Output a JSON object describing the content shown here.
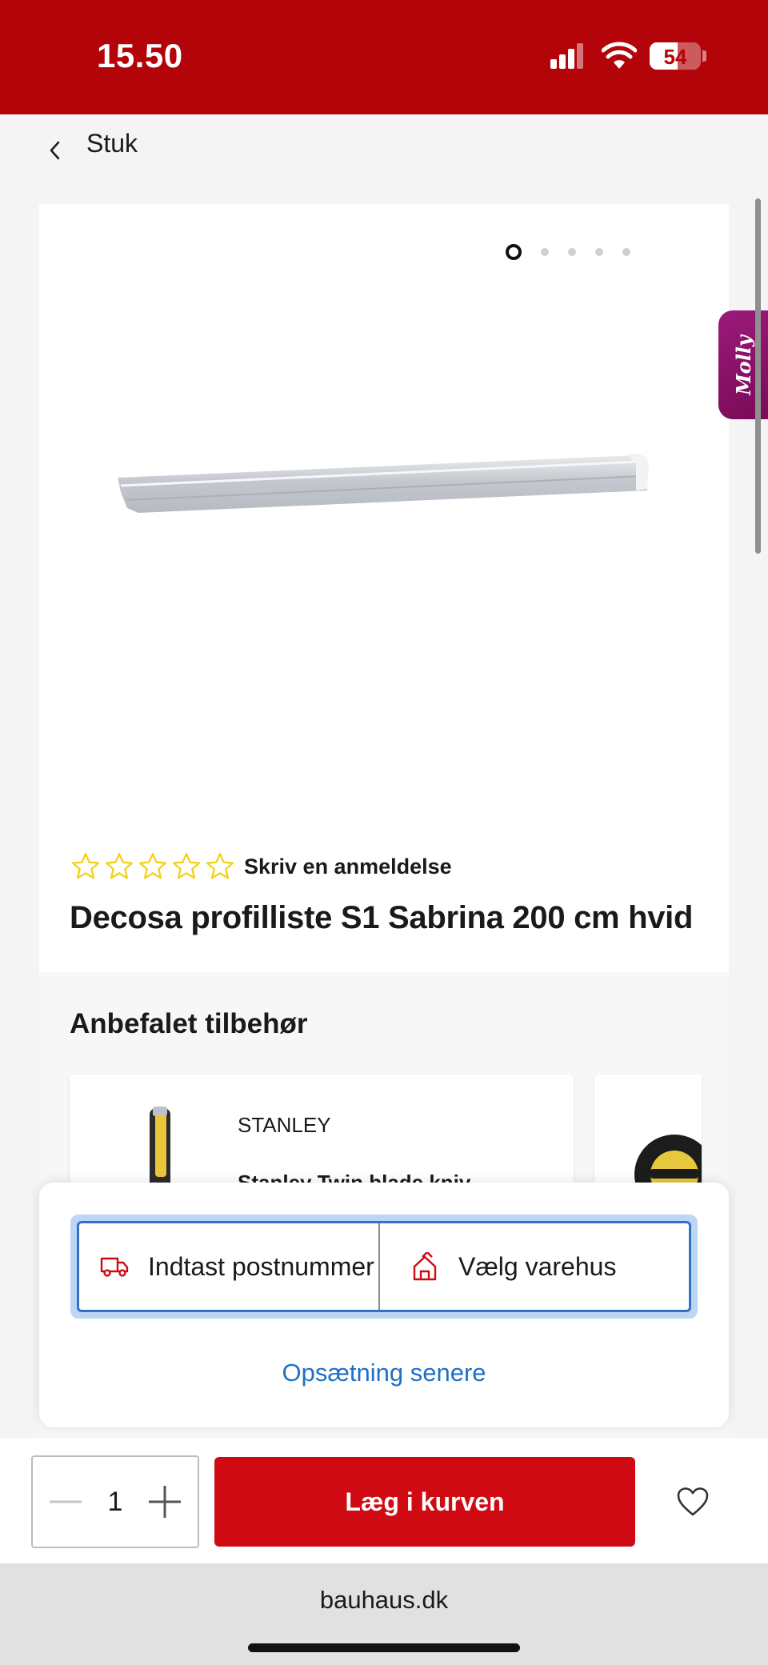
{
  "status_bar": {
    "time": "15.50",
    "battery": "54"
  },
  "nav": {
    "title": "Stuk"
  },
  "gallery": {
    "total_images": 5,
    "active_index": 0
  },
  "product": {
    "rating_stars": 0,
    "review_link": "Skriv en anmeldelse",
    "title": "Decosa profilliste S1 Sabrina 200 cm hvid"
  },
  "accessories": {
    "heading": "Anbefalet tilbehør",
    "items": [
      {
        "brand": "STANLEY",
        "name": "Stanley Twin blade kniv"
      }
    ]
  },
  "assistant_tab": {
    "label": "Molly"
  },
  "delivery_sheet": {
    "zip_label": "Indtast postnummer",
    "store_label": "Vælg varehus",
    "later_link": "Opsætning senere"
  },
  "cart_bar": {
    "quantity": "1",
    "add_to_cart": "Læg i kurven"
  },
  "browser": {
    "url": "bauhaus.dk"
  },
  "colors": {
    "brand_red": "#b30409",
    "button_red": "#cf0a12",
    "link_blue": "#1f6fc5",
    "star_yellow": "#f2d21b"
  },
  "icons": [
    "back-chevron-icon",
    "star-outline-icon",
    "truck-icon",
    "store-icon",
    "minus-icon",
    "plus-icon",
    "heart-icon"
  ]
}
